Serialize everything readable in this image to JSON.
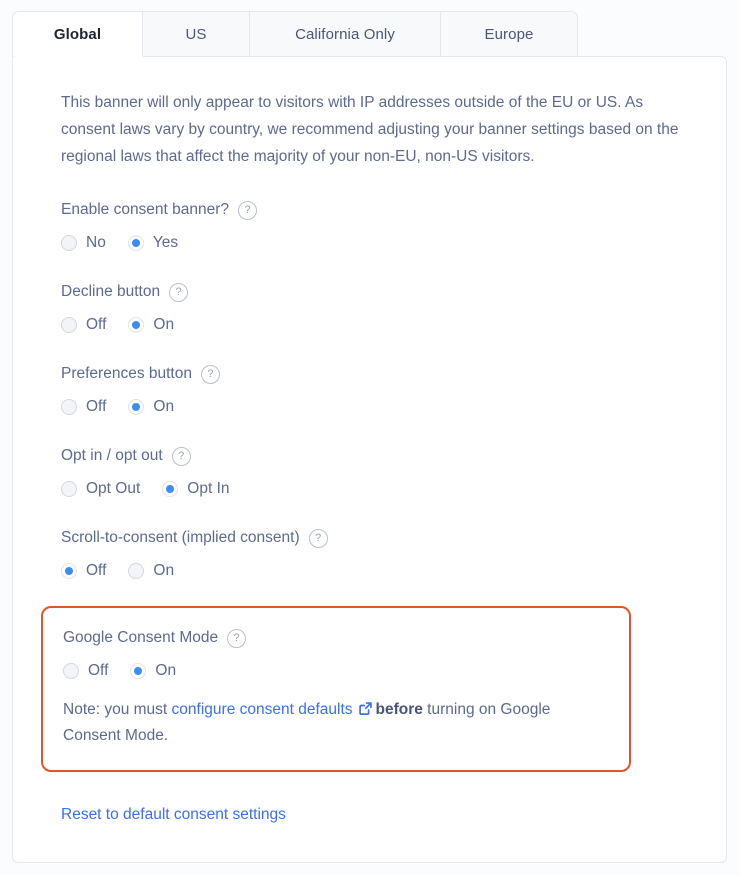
{
  "tabs": [
    {
      "label": "Global",
      "active": true
    },
    {
      "label": "US",
      "active": false
    },
    {
      "label": "California Only",
      "active": false
    },
    {
      "label": "Europe",
      "active": false
    }
  ],
  "intro": "This banner will only appear to visitors with IP addresses outside of the EU or US. As consent laws vary by country, we recommend adjusting your banner settings based on the regional laws that affect the majority of your non-EU, non-US visitors.",
  "help_glyph": "?",
  "fields": [
    {
      "label": "Enable consent banner?",
      "options": [
        {
          "label": "No",
          "selected": false
        },
        {
          "label": "Yes",
          "selected": true
        }
      ]
    },
    {
      "label": "Decline button",
      "options": [
        {
          "label": "Off",
          "selected": false
        },
        {
          "label": "On",
          "selected": true
        }
      ]
    },
    {
      "label": "Preferences button",
      "options": [
        {
          "label": "Off",
          "selected": false
        },
        {
          "label": "On",
          "selected": true
        }
      ]
    },
    {
      "label": "Opt in / opt out",
      "options": [
        {
          "label": "Opt Out",
          "selected": false
        },
        {
          "label": "Opt In",
          "selected": true
        }
      ]
    },
    {
      "label": "Scroll-to-consent (implied consent)",
      "options": [
        {
          "label": "Off",
          "selected": true
        },
        {
          "label": "On",
          "selected": false
        }
      ]
    }
  ],
  "google_consent_mode": {
    "label": "Google Consent Mode",
    "options": [
      {
        "label": "Off",
        "selected": false
      },
      {
        "label": "On",
        "selected": true
      }
    ],
    "note_prefix": "Note: you must ",
    "note_link": "configure consent defaults",
    "note_bold": "before",
    "note_suffix": " turning on Google Consent Mode.",
    "highlight_color": "#e4542c"
  },
  "reset_link": "Reset to default consent settings",
  "colors": {
    "accent_blue": "#3b8ef0",
    "link_blue": "#3b6ef5",
    "text": "#5d6a8e",
    "border": "#e4e7ec"
  }
}
